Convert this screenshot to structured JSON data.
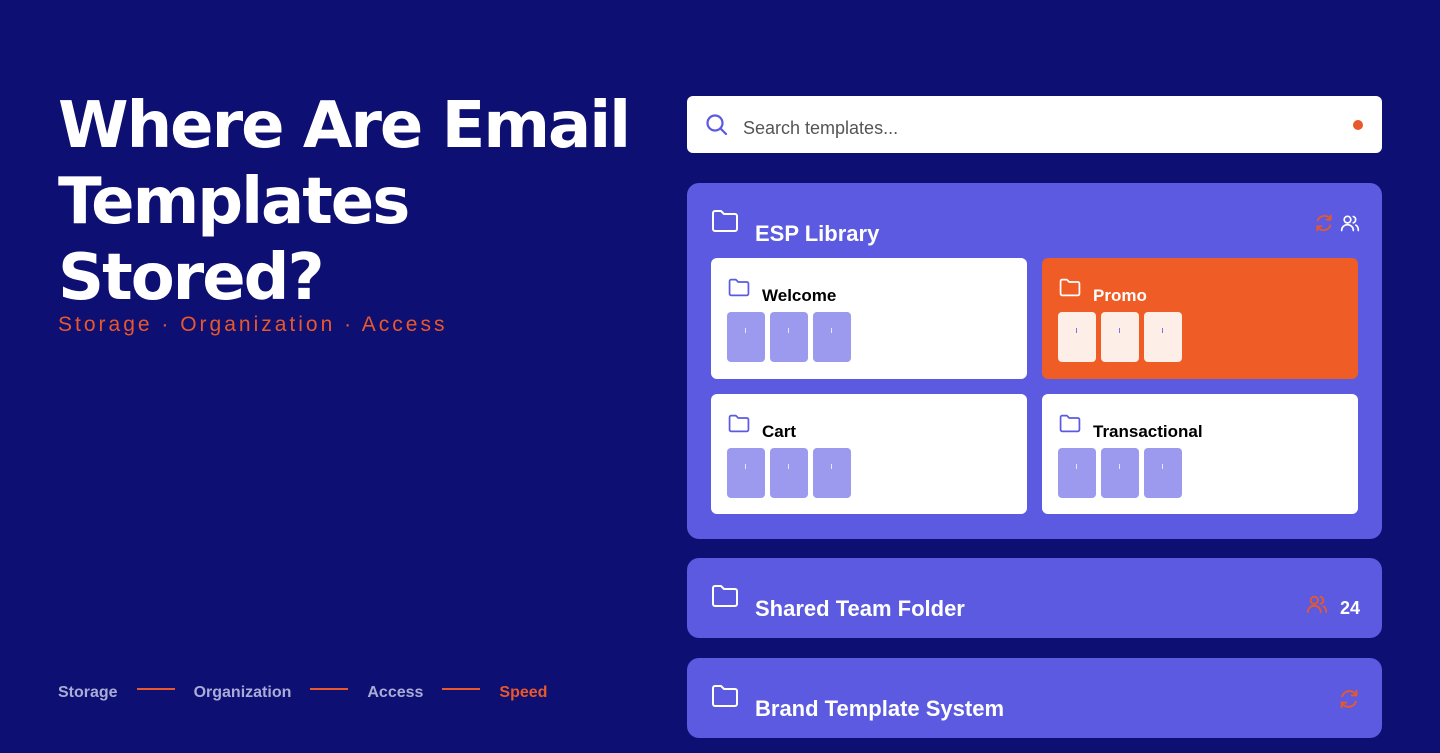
{
  "hero": {
    "title_lines": [
      "Where Are Email",
      "Templates",
      "Stored?"
    ],
    "subtitle": "Storage · Organization · Access"
  },
  "steps": [
    {
      "label": "Storage",
      "active": false
    },
    {
      "label": "Organization",
      "active": false
    },
    {
      "label": "Access",
      "active": false
    },
    {
      "label": "Speed",
      "active": true
    }
  ],
  "search": {
    "placeholder": "Search templates...",
    "icon": "search-icon",
    "indicator_color": "#e8582a"
  },
  "library": {
    "title": "ESP Library",
    "icons": [
      "sync-icon",
      "users-icon"
    ],
    "cards": [
      {
        "title": "Welcome",
        "highlighted": false
      },
      {
        "title": "Promo",
        "highlighted": true
      },
      {
        "title": "Cart",
        "highlighted": false
      },
      {
        "title": "Transactional",
        "highlighted": false
      }
    ]
  },
  "shared": {
    "title": "Shared Team Folder",
    "icon": "users-icon",
    "count": "24"
  },
  "brand": {
    "title": "Brand Template System",
    "icon": "sync-icon"
  },
  "colors": {
    "background": "#0e0f72",
    "accent": "#e8582a",
    "panel": "#5b5ae0",
    "thumb": "#9b9aee"
  }
}
